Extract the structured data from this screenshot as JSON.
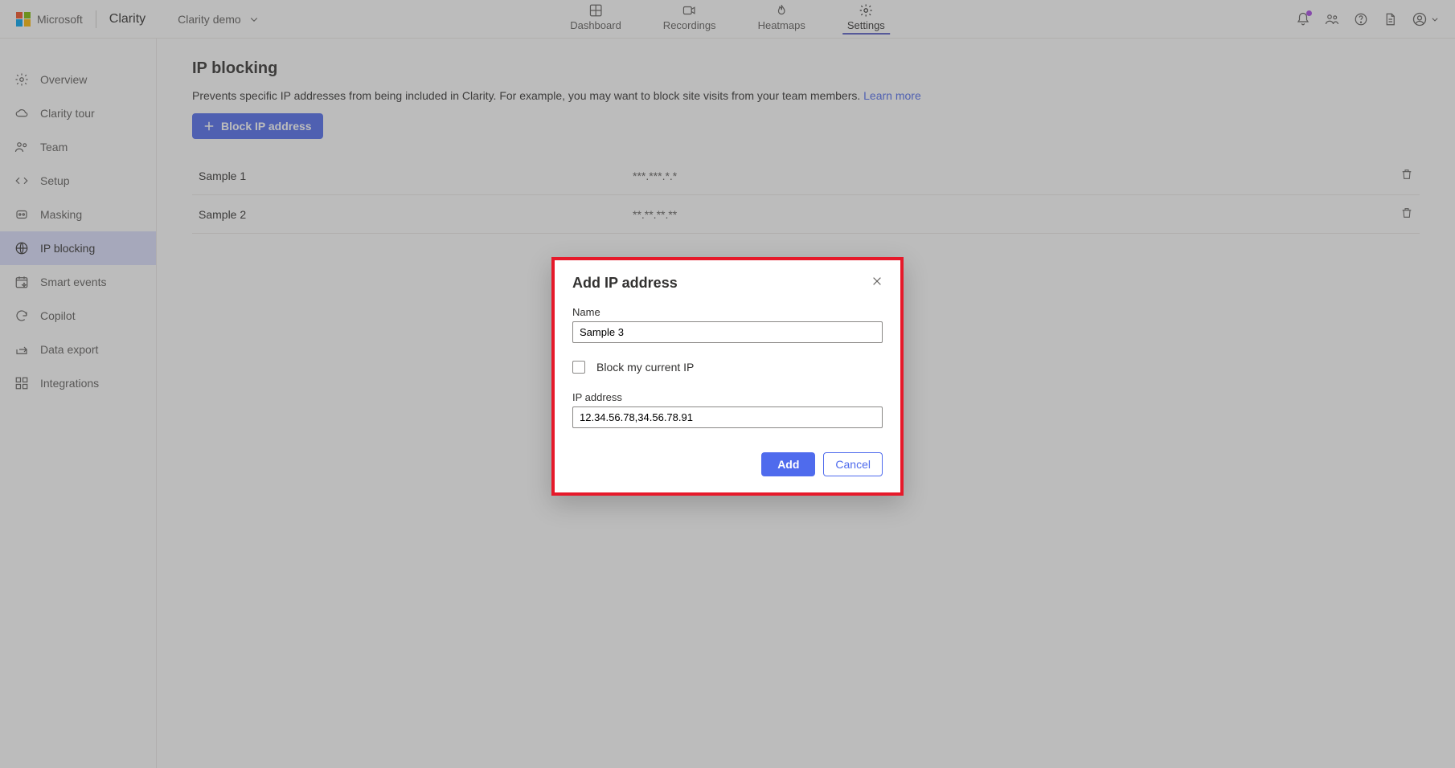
{
  "header": {
    "brand": "Microsoft",
    "product": "Clarity",
    "project": "Clarity demo",
    "nav": [
      {
        "id": "dashboard",
        "label": "Dashboard"
      },
      {
        "id": "recordings",
        "label": "Recordings"
      },
      {
        "id": "heatmaps",
        "label": "Heatmaps"
      },
      {
        "id": "settings",
        "label": "Settings"
      }
    ]
  },
  "sidebar": {
    "items": [
      {
        "id": "overview",
        "label": "Overview"
      },
      {
        "id": "clarity-tour",
        "label": "Clarity tour"
      },
      {
        "id": "team",
        "label": "Team"
      },
      {
        "id": "setup",
        "label": "Setup"
      },
      {
        "id": "masking",
        "label": "Masking"
      },
      {
        "id": "ip-blocking",
        "label": "IP blocking"
      },
      {
        "id": "smart-events",
        "label": "Smart events"
      },
      {
        "id": "copilot",
        "label": "Copilot"
      },
      {
        "id": "data-export",
        "label": "Data export"
      },
      {
        "id": "integrations",
        "label": "Integrations"
      }
    ]
  },
  "page": {
    "title": "IP blocking",
    "description": "Prevents specific IP addresses from being included in Clarity. For example, you may want to block site visits from your team members. ",
    "learn_more": "Learn more",
    "block_button": "Block IP address",
    "rows": [
      {
        "name": "Sample 1",
        "ip": "***.***.*.*"
      },
      {
        "name": "Sample 2",
        "ip": "**.**.**.**"
      }
    ]
  },
  "modal": {
    "title": "Add IP address",
    "name_label": "Name",
    "name_value": "Sample 3",
    "block_current_label": "Block my current IP",
    "ip_label": "IP address",
    "ip_value": "12.34.56.78,34.56.78.91",
    "add_label": "Add",
    "cancel_label": "Cancel"
  }
}
